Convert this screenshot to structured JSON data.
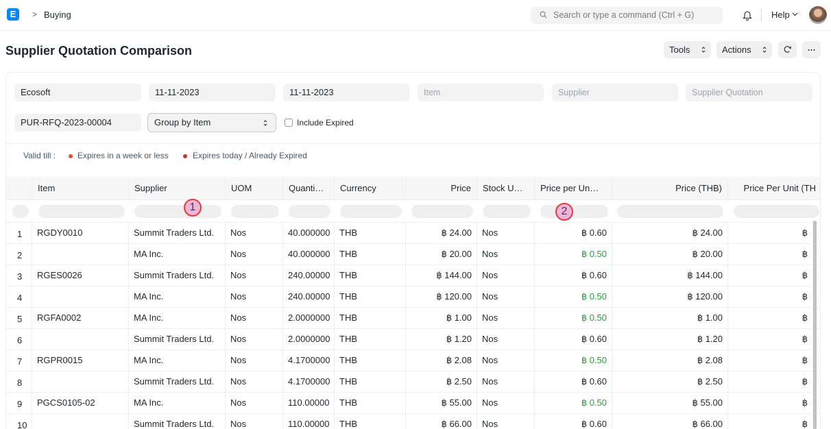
{
  "navbar": {
    "logo": "E",
    "breadcrumb_sep": ">",
    "breadcrumb": "Buying",
    "search_placeholder": "Search or type a command (Ctrl + G)",
    "help": "Help"
  },
  "page": {
    "title": "Supplier Quotation Comparison",
    "tools": "Tools",
    "actions": "Actions"
  },
  "filters": {
    "company": "Ecosoft",
    "from_date": "11-11-2023",
    "to_date": "11-11-2023",
    "item_placeholder": "Item",
    "supplier_placeholder": "Supplier",
    "quotation_placeholder": "Supplier Quotation",
    "rfq": "PUR-RFQ-2023-00004",
    "group_by": "Group by Item",
    "include_expired": "Include Expired"
  },
  "legend": {
    "label": "Valid till :",
    "week": "Expires in a week or less",
    "today": "Expires today / Already Expired",
    "week_color": "#e0531f",
    "today_color": "#c0392b"
  },
  "columns": [
    "Item",
    "Supplier",
    "UOM",
    "Quanti…",
    "Currency",
    "Price",
    "Stock U…",
    "Price per Un…",
    "Price (THB)",
    "Price Per Unit (TH"
  ],
  "rows": [
    {
      "idx": "1",
      "item": "RGDY0010",
      "supplier": "Summit Traders Ltd.",
      "uom": "Nos",
      "qty": "40.000000",
      "currency": "THB",
      "price": "฿ 24.00",
      "stock_uom": "Nos",
      "ppu": "฿ 0.60",
      "ppu_green": false,
      "price_thb": "฿ 24.00",
      "ppu_thb": "฿"
    },
    {
      "idx": "2",
      "item": "",
      "supplier": "MA Inc.",
      "uom": "Nos",
      "qty": "40.000000",
      "currency": "THB",
      "price": "฿ 20.00",
      "stock_uom": "Nos",
      "ppu": "฿ 0.50",
      "ppu_green": true,
      "price_thb": "฿ 20.00",
      "ppu_thb": "฿"
    },
    {
      "idx": "3",
      "item": "RGES0026",
      "supplier": "Summit Traders Ltd.",
      "uom": "Nos",
      "qty": "240.00000",
      "currency": "THB",
      "price": "฿ 144.00",
      "stock_uom": "Nos",
      "ppu": "฿ 0.60",
      "ppu_green": false,
      "price_thb": "฿ 144.00",
      "ppu_thb": "฿"
    },
    {
      "idx": "4",
      "item": "",
      "supplier": "MA Inc.",
      "uom": "Nos",
      "qty": "240.00000",
      "currency": "THB",
      "price": "฿ 120.00",
      "stock_uom": "Nos",
      "ppu": "฿ 0.50",
      "ppu_green": true,
      "price_thb": "฿ 120.00",
      "ppu_thb": "฿"
    },
    {
      "idx": "5",
      "item": "RGFA0002",
      "supplier": "MA Inc.",
      "uom": "Nos",
      "qty": "2.0000000",
      "currency": "THB",
      "price": "฿ 1.00",
      "stock_uom": "Nos",
      "ppu": "฿ 0.50",
      "ppu_green": true,
      "price_thb": "฿ 1.00",
      "ppu_thb": "฿"
    },
    {
      "idx": "6",
      "item": "",
      "supplier": "Summit Traders Ltd.",
      "uom": "Nos",
      "qty": "2.0000000",
      "currency": "THB",
      "price": "฿ 1.20",
      "stock_uom": "Nos",
      "ppu": "฿ 0.60",
      "ppu_green": false,
      "price_thb": "฿ 1.20",
      "ppu_thb": "฿"
    },
    {
      "idx": "7",
      "item": "RGPR0015",
      "supplier": "MA Inc.",
      "uom": "Nos",
      "qty": "4.1700000",
      "currency": "THB",
      "price": "฿ 2.08",
      "stock_uom": "Nos",
      "ppu": "฿ 0.50",
      "ppu_green": true,
      "price_thb": "฿ 2.08",
      "ppu_thb": "฿"
    },
    {
      "idx": "8",
      "item": "",
      "supplier": "Summit Traders Ltd.",
      "uom": "Nos",
      "qty": "4.1700000",
      "currency": "THB",
      "price": "฿ 2.50",
      "stock_uom": "Nos",
      "ppu": "฿ 0.60",
      "ppu_green": false,
      "price_thb": "฿ 2.50",
      "ppu_thb": "฿"
    },
    {
      "idx": "9",
      "item": "PGCS0105-02",
      "supplier": "MA Inc.",
      "uom": "Nos",
      "qty": "110.00000",
      "currency": "THB",
      "price": "฿ 55.00",
      "stock_uom": "Nos",
      "ppu": "฿ 0.50",
      "ppu_green": true,
      "price_thb": "฿ 55.00",
      "ppu_thb": "฿"
    },
    {
      "idx": "10",
      "item": "",
      "supplier": "Summit Traders Ltd.",
      "uom": "Nos",
      "qty": "110.00000",
      "currency": "THB",
      "price": "฿ 66.00",
      "stock_uom": "Nos",
      "ppu": "฿ 0.60",
      "ppu_green": false,
      "price_thb": "฿ 66.00",
      "ppu_thb": "฿"
    }
  ],
  "markers": [
    "1",
    "2"
  ]
}
